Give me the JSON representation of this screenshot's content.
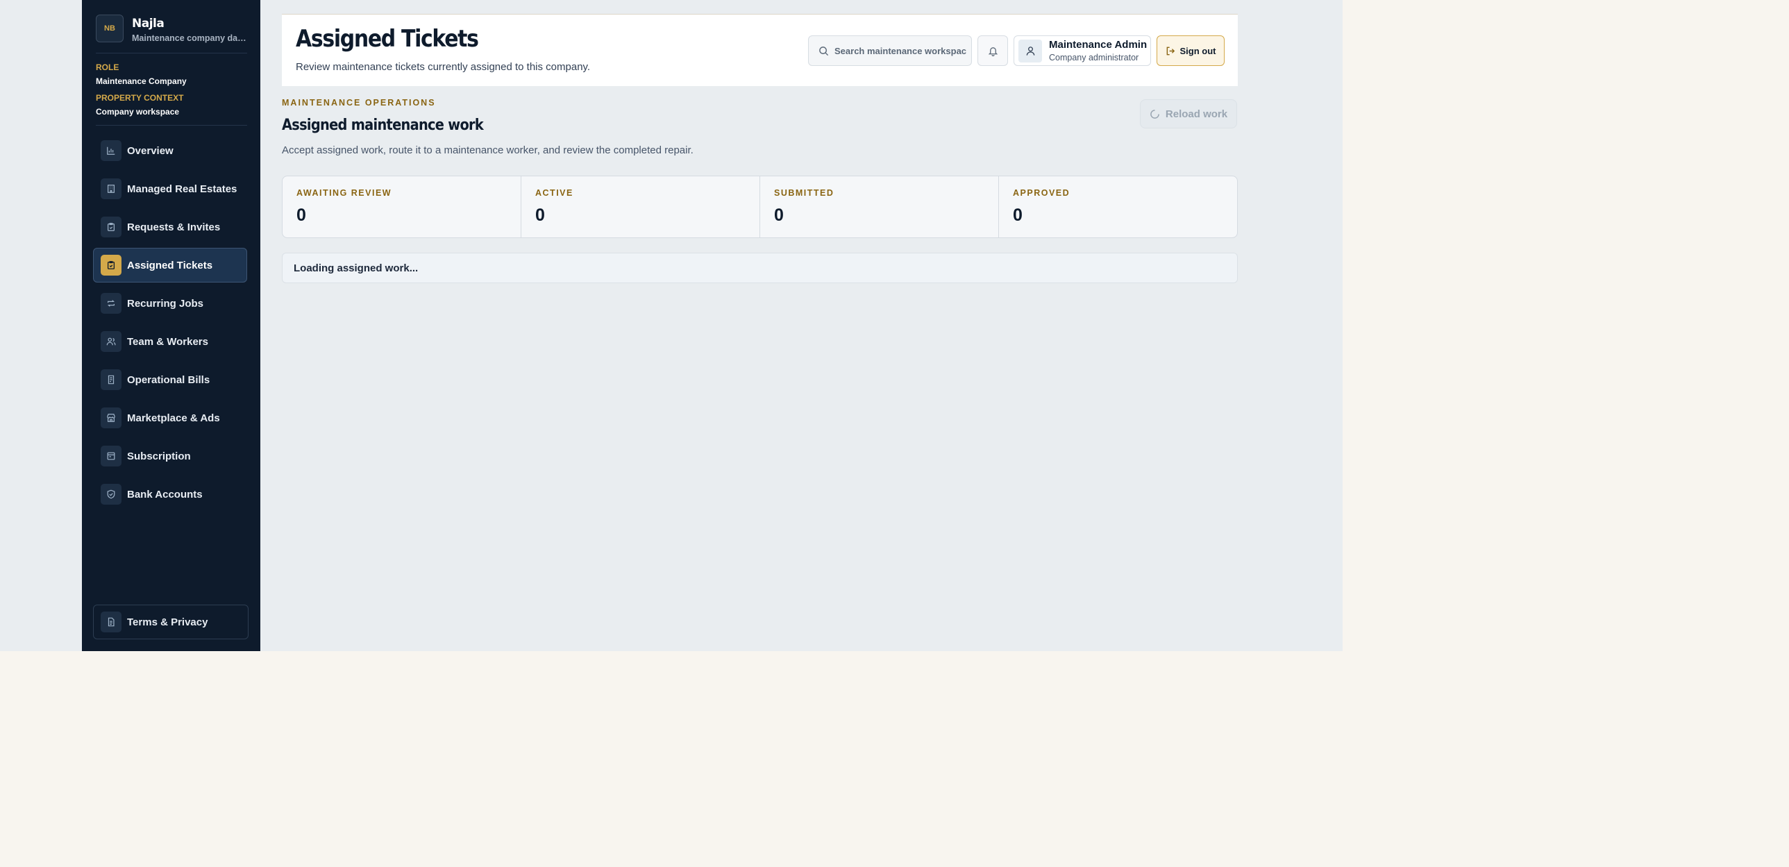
{
  "sidebar": {
    "brand_name": "Najla",
    "brand_logo_text": "NB",
    "brand_subtitle": "Maintenance company dashboard",
    "role_label": "ROLE",
    "role_value": "Maintenance Company",
    "context_label": "PROPERTY CONTEXT",
    "context_value": "Company workspace",
    "items": [
      {
        "label": "Overview",
        "icon": "bar-chart-icon"
      },
      {
        "label": "Managed Real Estates",
        "icon": "building-icon"
      },
      {
        "label": "Requests & Invites",
        "icon": "clipboard-check-icon"
      },
      {
        "label": "Assigned Tickets",
        "icon": "clipboard-icon",
        "active": true
      },
      {
        "label": "Recurring Jobs",
        "icon": "repeat-icon"
      },
      {
        "label": "Team & Workers",
        "icon": "users-icon"
      },
      {
        "label": "Operational Bills",
        "icon": "receipt-icon"
      },
      {
        "label": "Marketplace & Ads",
        "icon": "store-icon"
      },
      {
        "label": "Subscription",
        "icon": "card-icon"
      },
      {
        "label": "Bank Accounts",
        "icon": "shield-check-icon"
      }
    ],
    "footer_item": {
      "label": "Terms & Privacy",
      "icon": "document-icon"
    }
  },
  "header": {
    "title": "Assigned Tickets",
    "subtitle": "Review maintenance tickets currently assigned to this company.",
    "search_placeholder": "Search maintenance workspace",
    "user_name": "Maintenance Admin",
    "user_role": "Company administrator",
    "signout_label": "Sign out"
  },
  "main": {
    "eyebrow": "MAINTENANCE OPERATIONS",
    "title": "Assigned maintenance work",
    "description": "Accept assigned work, route it to a maintenance worker, and review the completed repair.",
    "reload_label": "Reload work",
    "stats": [
      {
        "label": "AWAITING REVIEW",
        "value": "0"
      },
      {
        "label": "ACTIVE",
        "value": "0"
      },
      {
        "label": "SUBMITTED",
        "value": "0"
      },
      {
        "label": "APPROVED",
        "value": "0"
      }
    ],
    "loading_text": "Loading assigned work..."
  },
  "colors": {
    "sidebar_bg": "#0e1b2c",
    "accent_gold": "#d4a94a",
    "eyebrow": "#8a6513",
    "app_bg": "#e9edf0",
    "outer_bg": "#f8f5ef"
  }
}
